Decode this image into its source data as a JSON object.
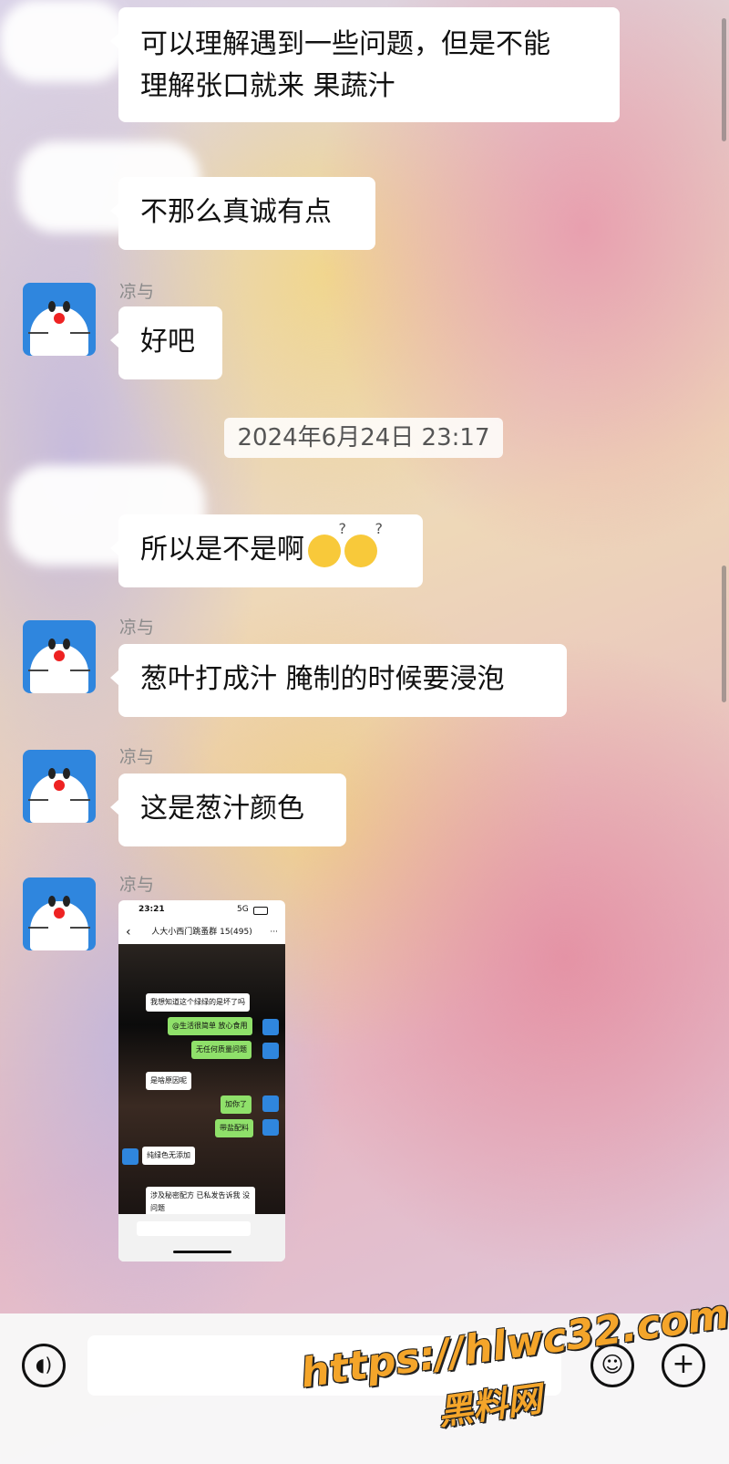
{
  "messages": [
    {
      "id": "m1",
      "sender": "",
      "lines": [
        "可以理解遇到一些问题，但是不能",
        "理解张口就来 果蔬汁"
      ]
    },
    {
      "id": "m2",
      "sender": "",
      "lines": [
        "不那么真诚有点"
      ]
    },
    {
      "id": "m3",
      "sender": "凉与",
      "lines": [
        "好吧"
      ]
    },
    {
      "id": "m4",
      "sender": "",
      "lines": [
        "所以是不是啊"
      ]
    },
    {
      "id": "m5",
      "sender": "凉与",
      "lines": [
        "葱叶打成汁 腌制的时候要浸泡"
      ]
    },
    {
      "id": "m6",
      "sender": "凉与",
      "lines": [
        "这是葱汁颜色"
      ]
    },
    {
      "id": "m7",
      "sender": "凉与",
      "type": "image"
    }
  ],
  "timestamp": "2024年6月24日 23:17",
  "emoji_icons": [
    "thinking-face-icon",
    "thinking-face-icon"
  ],
  "screenshot": {
    "status_time": "23:21",
    "status_signal": "5G",
    "title": "人大小西门跳蚤群 15(495)",
    "more": "···",
    "back": "‹",
    "chat": [
      {
        "text": "我想知道这个绿绿的是坏了吗",
        "side": "left"
      },
      {
        "text": "@生活很简单 放心食用",
        "side": "right"
      },
      {
        "text": "无任何质量问题",
        "side": "right"
      },
      {
        "text": "是啥原因呢",
        "side": "left"
      },
      {
        "text": "加你了",
        "side": "right"
      },
      {
        "text": "带盐配料",
        "side": "right"
      },
      {
        "text": "纯绿色无添加",
        "side": "left"
      },
      {
        "text": "涉及秘密配方 已私发告诉我 没问题",
        "side": "left"
      }
    ]
  },
  "bottom_bar": {
    "voice_icon": "voice-icon",
    "emoji_icon": "emoji-icon",
    "plus_icon": "plus-icon"
  },
  "watermark": {
    "url": "https://hlwc32.com",
    "label": "黑料网"
  },
  "colors": {
    "bubble": "#ffffff",
    "accent_green": "#8fe06a",
    "watermark": "#f4a52a"
  }
}
